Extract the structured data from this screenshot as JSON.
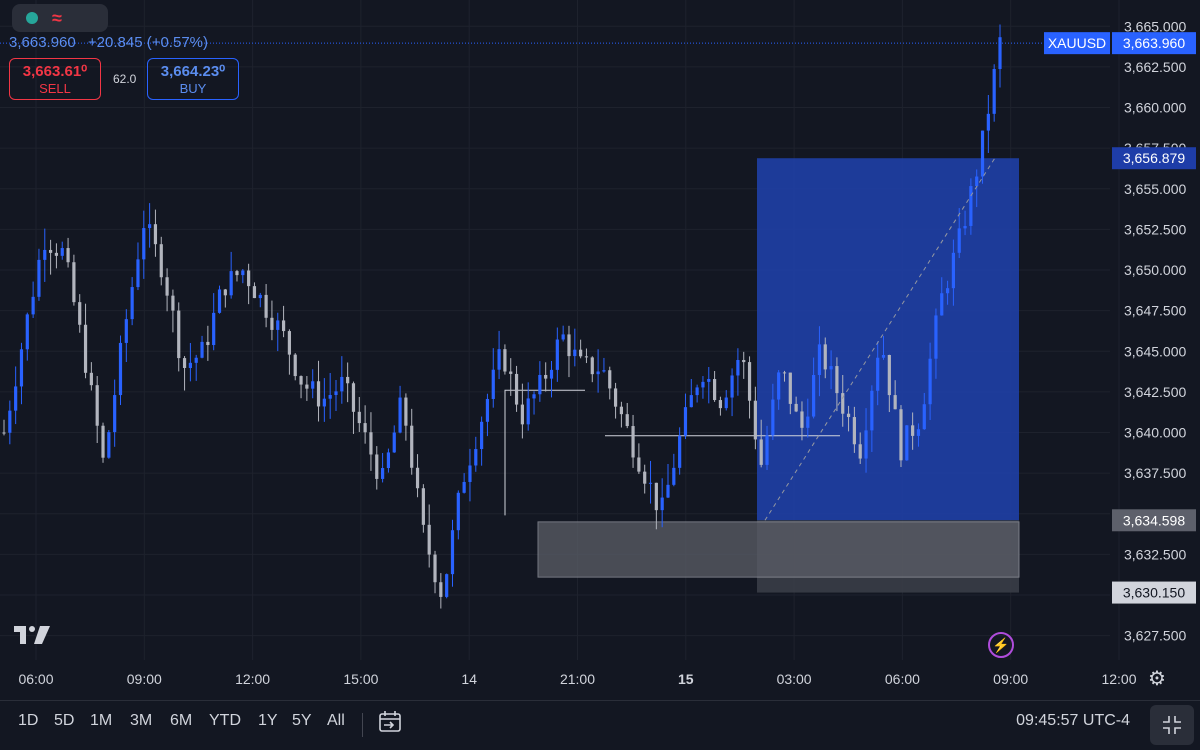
{
  "header": {
    "last_price": "3,663.960",
    "change": "+20.845 (+0.57%)",
    "sell_price": "3,663.61⁰",
    "sell_label": "SELL",
    "spread": "62.0",
    "buy_price": "3,664.23⁰",
    "buy_label": "BUY",
    "status_icons": [
      "market-open-dot-icon",
      "wave-icon"
    ]
  },
  "chart_data": {
    "type": "candlestick",
    "symbol": "XAUUSD",
    "y_range": [
      3626,
      3666
    ],
    "price_ticks": [
      "3,665.000",
      "3,662.500",
      "3,660.000",
      "3,657.500",
      "3,655.000",
      "3,652.500",
      "3,650.000",
      "3,647.500",
      "3,645.000",
      "3,642.500",
      "3,640.000",
      "3,637.500",
      "3,635.000",
      "3,632.500",
      "3,630.000",
      "3,627.500"
    ],
    "time_ticks": [
      {
        "label": "06:00",
        "bold": false
      },
      {
        "label": "09:00",
        "bold": false
      },
      {
        "label": "12:00",
        "bold": false
      },
      {
        "label": "15:00",
        "bold": false
      },
      {
        "label": "14",
        "bold": false
      },
      {
        "label": "21:00",
        "bold": false
      },
      {
        "label": "15",
        "bold": true
      },
      {
        "label": "03:00",
        "bold": false
      },
      {
        "label": "06:00",
        "bold": false
      },
      {
        "label": "09:00",
        "bold": false
      },
      {
        "label": "12:00",
        "bold": false
      }
    ],
    "price_path": [
      3640,
      3646,
      3652,
      3651,
      3645,
      3638,
      3646,
      3653,
      3650,
      3644,
      3645,
      3649,
      3650,
      3648,
      3646,
      3643,
      3642,
      3643,
      3640,
      3637,
      3642,
      3634,
      3630,
      3637,
      3641,
      3645,
      3641,
      3643,
      3646,
      3644,
      3644,
      3641,
      3638,
      3635,
      3640,
      3644,
      3642,
      3645,
      3638,
      3644,
      3640,
      3645,
      3642,
      3639,
      3646,
      3639,
      3641,
      3648,
      3652,
      3657,
      3664
    ],
    "last_price_label": "3,663.960",
    "markers": {
      "target_price": "3,656.879",
      "entry_price": "3,634.598",
      "stop_price": "3,630.150"
    },
    "zones": {
      "target": {
        "from": 3634.598,
        "to": 3656.879,
        "color": "#1f3fa6"
      },
      "stop": {
        "from": 3630.15,
        "to": 3634.598,
        "color": "#3a3d47"
      },
      "demand": {
        "from": 3631.1,
        "to": 3634.5,
        "color": "#5b5e67"
      }
    },
    "levels": [
      3642.6,
      3639.8
    ],
    "grid": true
  },
  "bottom_bar": {
    "ranges": [
      "1D",
      "5D",
      "1M",
      "3M",
      "6M",
      "YTD",
      "1Y",
      "5Y",
      "All"
    ],
    "clock": "09:45:57 UTC-4",
    "icons": [
      "calendar-goto-icon",
      "fullscreen-icon"
    ]
  },
  "colors": {
    "background": "#131722",
    "up": "#2962ff",
    "down": "#b2b5be",
    "sell": "#f23645",
    "buy": "#2962ff"
  }
}
